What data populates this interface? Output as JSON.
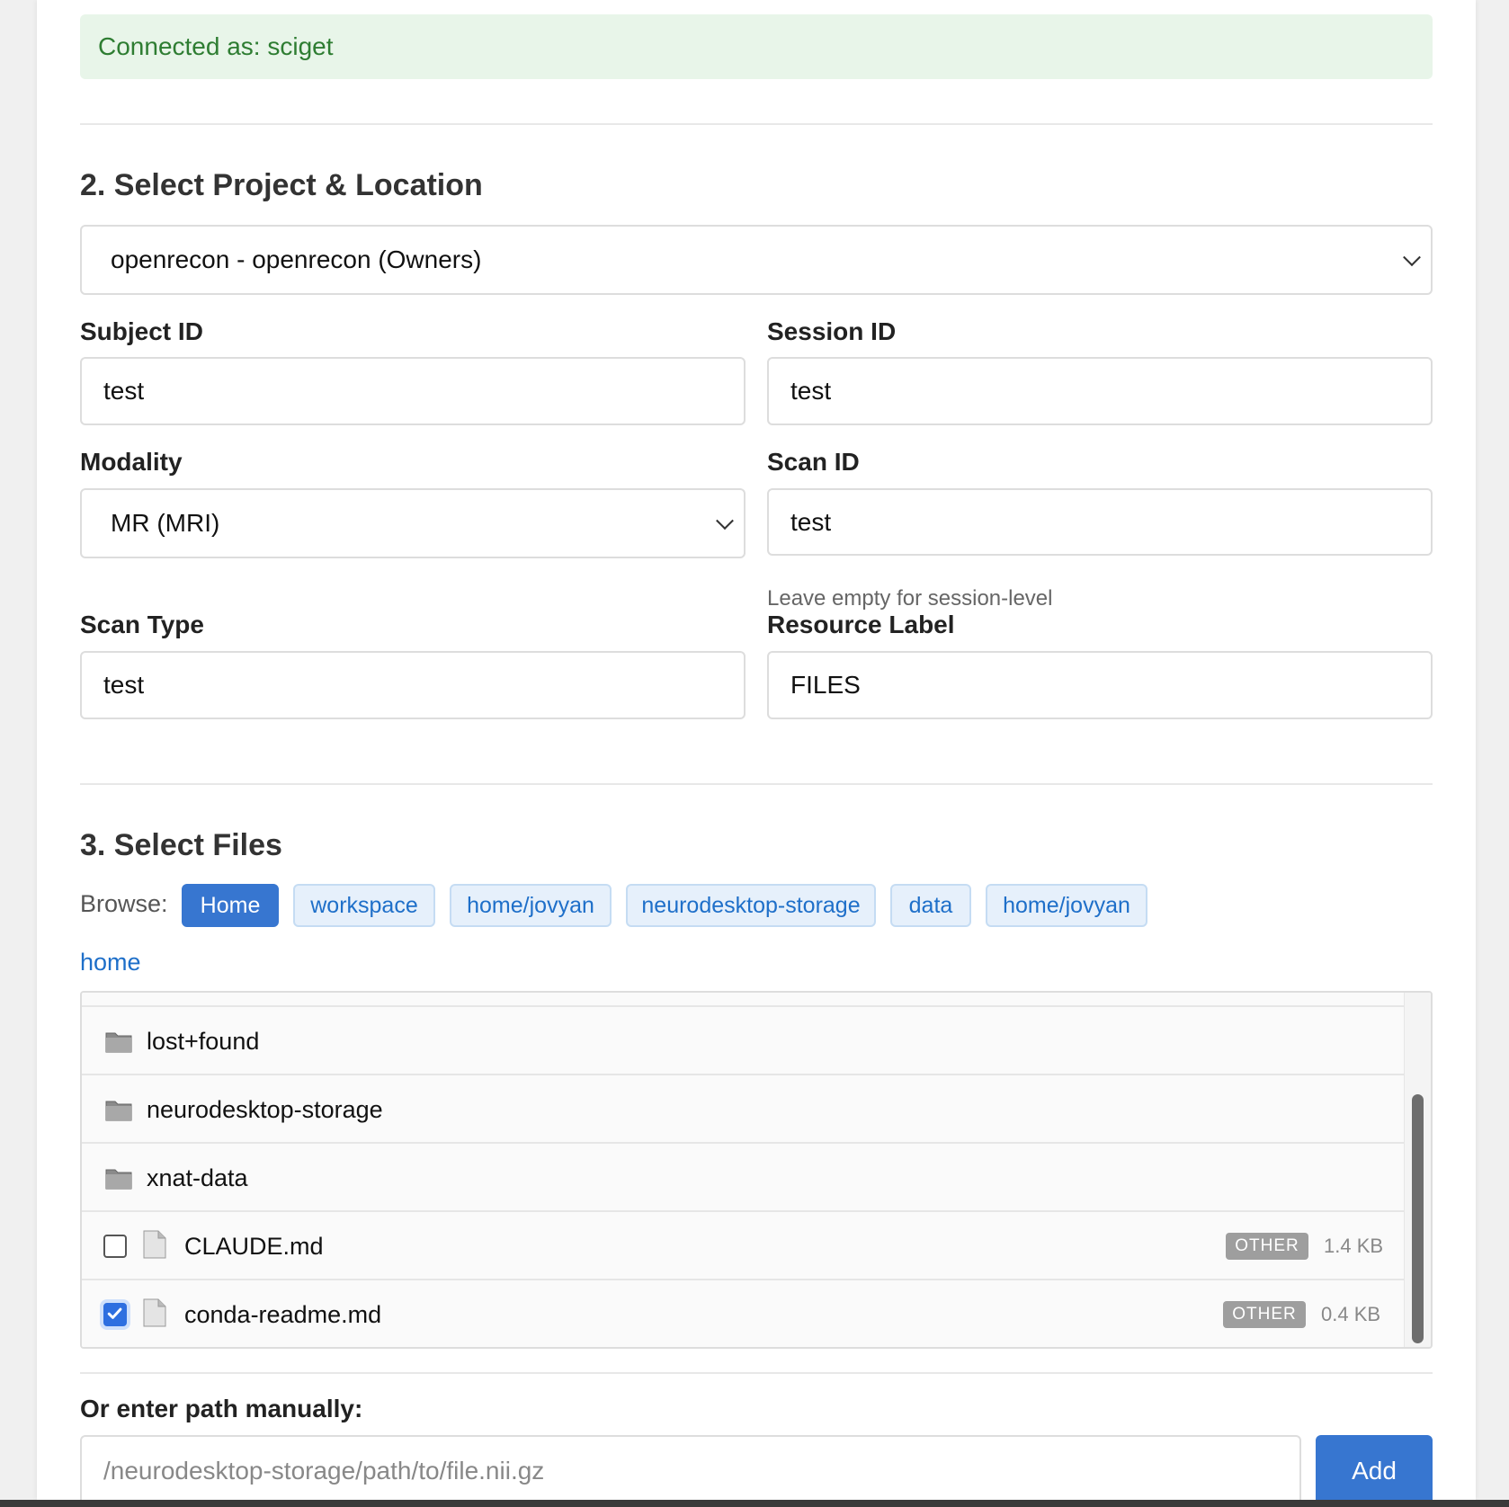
{
  "status": {
    "text": "Connected as: sciget"
  },
  "section2": {
    "title": "2. Select Project & Location",
    "project_select": "openrecon - openrecon (Owners)",
    "subject_label": "Subject ID",
    "subject_value": "test",
    "session_label": "Session ID",
    "session_value": "test",
    "modality_label": "Modality",
    "modality_value": "MR (MRI)",
    "scan_id_label": "Scan ID",
    "scan_id_value": "test",
    "scan_hint": "Leave empty for session-level",
    "scan_type_label": "Scan Type",
    "scan_type_value": "test",
    "resource_label": "Resource Label",
    "resource_value": "FILES"
  },
  "section3": {
    "title": "3. Select Files",
    "browse_label": "Browse:",
    "chips": [
      "Home",
      "workspace",
      "home/jovyan",
      "neurodesktop-storage",
      "data",
      "home/jovyan"
    ],
    "breadcrumb": "home",
    "folders": [
      "lost+found",
      "neurodesktop-storage",
      "xnat-data"
    ],
    "files": [
      {
        "name": "CLAUDE.md",
        "type": "OTHER",
        "size": "1.4 KB",
        "checked": false
      },
      {
        "name": "conda-readme.md",
        "type": "OTHER",
        "size": "0.4 KB",
        "checked": true
      }
    ],
    "manual_label": "Or enter path manually:",
    "manual_placeholder": "/neurodesktop-storage/path/to/file.nii.gz",
    "add_label": "Add"
  },
  "colors": {
    "accent": "#3776d0",
    "success_bg": "#e8f5e9",
    "success_text": "#2e7d32"
  },
  "icons": [
    "folder-icon",
    "file-icon",
    "chevron-down-icon",
    "checkbox-icon"
  ]
}
